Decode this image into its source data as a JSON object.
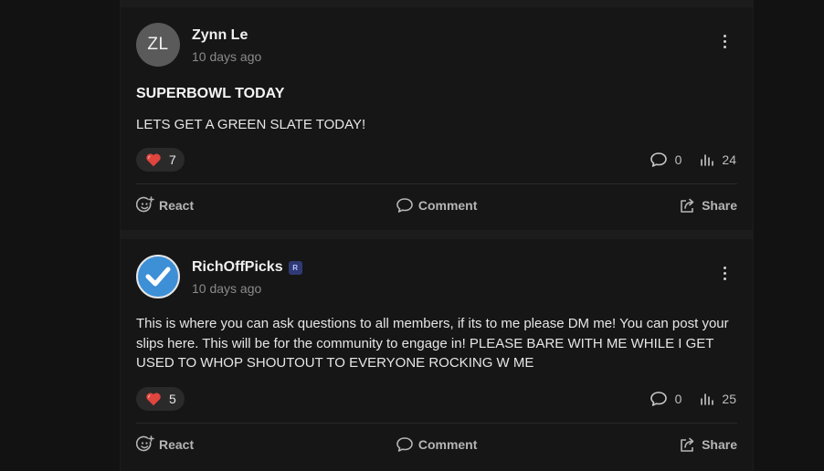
{
  "posts": [
    {
      "author": "Zynn Le",
      "avatar_initials": "ZL",
      "time": "10 days ago",
      "title": "SUPERBOWL TODAY",
      "body": "LETS GET A GREEN SLATE TODAY!",
      "reaction_count": "7",
      "comment_count": "0",
      "view_count": "24"
    },
    {
      "author": "RichOffPicks",
      "badge": "R",
      "time": "10 days ago",
      "body": "This is where you can ask questions to all members, if its to me please DM me! You can post your slips here. This will be for the community to engage in! PLEASE BARE WITH ME WHILE I GET USED TO WHOP SHOUTOUT TO EVERYONE ROCKING W ME",
      "reaction_count": "5",
      "comment_count": "0",
      "view_count": "25"
    }
  ],
  "actions": {
    "react": "React",
    "comment": "Comment",
    "share": "Share"
  },
  "icons": {
    "reaction": "heart-icon",
    "comments": "speech-bubble-icon",
    "views": "bar-chart-icon",
    "react": "smiley-plus-icon",
    "share": "share-arrow-icon",
    "menu": "vertical-ellipsis-icon"
  },
  "colors": {
    "background": "#121212",
    "card": "#161616",
    "heart": "#e0453e",
    "verified_avatar": "#3d8fd6",
    "badge": "#2f3a74"
  }
}
